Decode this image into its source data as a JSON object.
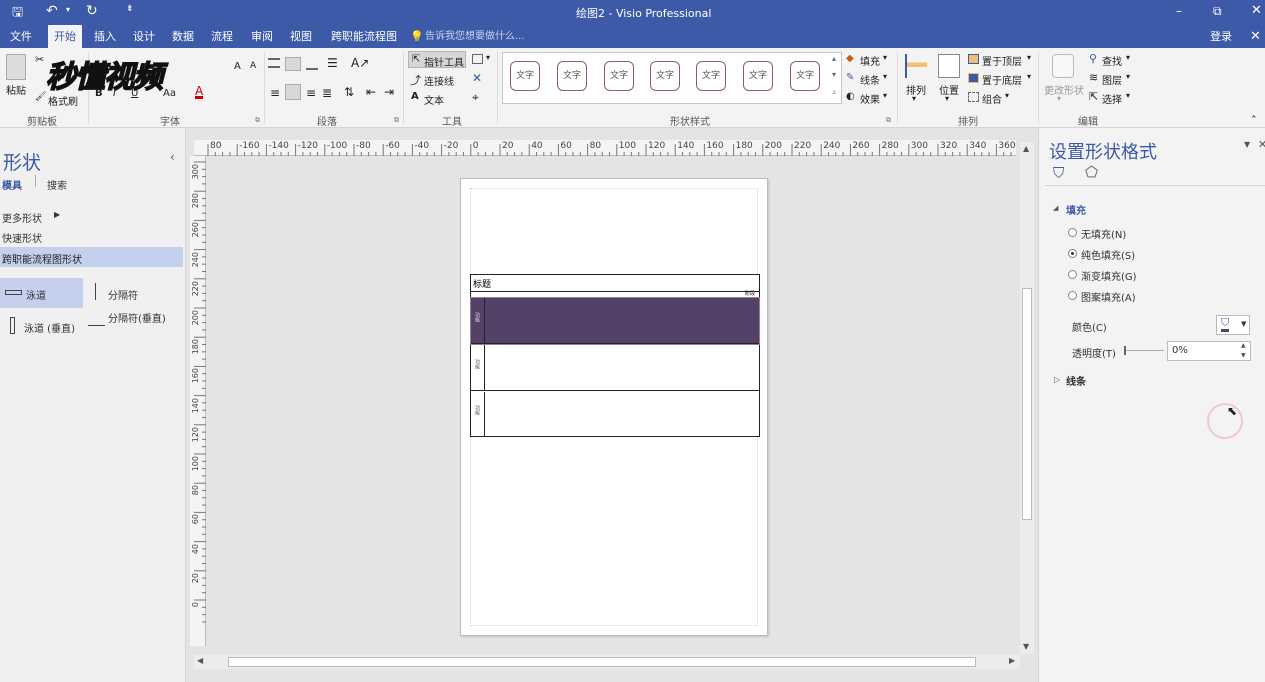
{
  "title_bar": {
    "title": "绘图2 - Visio Professional",
    "minimize": "–",
    "restore": "⧉",
    "close": "✕"
  },
  "tabs": [
    "文件",
    "开始",
    "插入",
    "设计",
    "数据",
    "流程",
    "审阅",
    "视图",
    "跨职能流程图"
  ],
  "tell_me": "告诉我您想要做什么...",
  "login": "登录",
  "ribbon": {
    "clipboard": {
      "paste": "粘贴",
      "format_painter": "格式刷",
      "label": "剪贴板"
    },
    "font": {
      "label": "字体",
      "size_hint": "Aa"
    },
    "paragraph": {
      "label": "段落"
    },
    "tools": {
      "pointer": "指针工具",
      "connector": "连接线",
      "text": "文本",
      "label": "工具"
    },
    "shape_styles": {
      "tile_text": "文字",
      "count": 7,
      "fill": "填充",
      "line": "线条",
      "effects": "效果",
      "label": "形状样式"
    },
    "arrange": {
      "align": "排列",
      "position": "位置",
      "bring_front": "置于顶层",
      "send_back": "置于底层",
      "group": "组合",
      "label": "排列"
    },
    "edit": {
      "change_shape": "更改形状",
      "find": "查找",
      "layers": "图层",
      "select": "选择",
      "label": "编辑"
    }
  },
  "watermark": "秒懂视频",
  "left_pane": {
    "title": "形状",
    "tab_stencil": "模具",
    "tab_search": "搜索",
    "more_shapes": "更多形状",
    "quick_shapes": "快速形状",
    "crossfunc_shapes": "跨职能流程图形状",
    "shapes": [
      {
        "label": "泳道"
      },
      {
        "label": "分隔符"
      },
      {
        "label": "泳道 (垂直)"
      },
      {
        "label": "分隔符(垂直)"
      }
    ]
  },
  "ruler": {
    "h_ticks": [
      "80",
      "-160",
      "-140",
      "-120",
      "-100",
      "-80",
      "-60",
      "-40",
      "-20",
      "0",
      "20",
      "40",
      "60",
      "80",
      "100",
      "120",
      "140",
      "160",
      "180",
      "200",
      "220",
      "240",
      "260",
      "280",
      "300",
      "320",
      "340",
      "360"
    ],
    "v_ticks": [
      "300",
      "280",
      "260",
      "240",
      "220",
      "200",
      "180",
      "160",
      "140",
      "120",
      "100",
      "80",
      "60",
      "40",
      "20",
      "0"
    ]
  },
  "drawing": {
    "title": "标题",
    "phase": "阶段",
    "lane_label": "功能",
    "lane_fill": "#55406a"
  },
  "right_pane": {
    "title": "设置形状格式",
    "fill_section": "填充",
    "options": [
      "无填充(N)",
      "纯色填充(S)",
      "渐变填充(G)",
      "图案填充(A)"
    ],
    "selected_option": "纯色填充(S)",
    "color_label": "颜色(C)",
    "transparency_label": "透明度(T)",
    "transparency_value": "0%",
    "line_section": "线条"
  }
}
